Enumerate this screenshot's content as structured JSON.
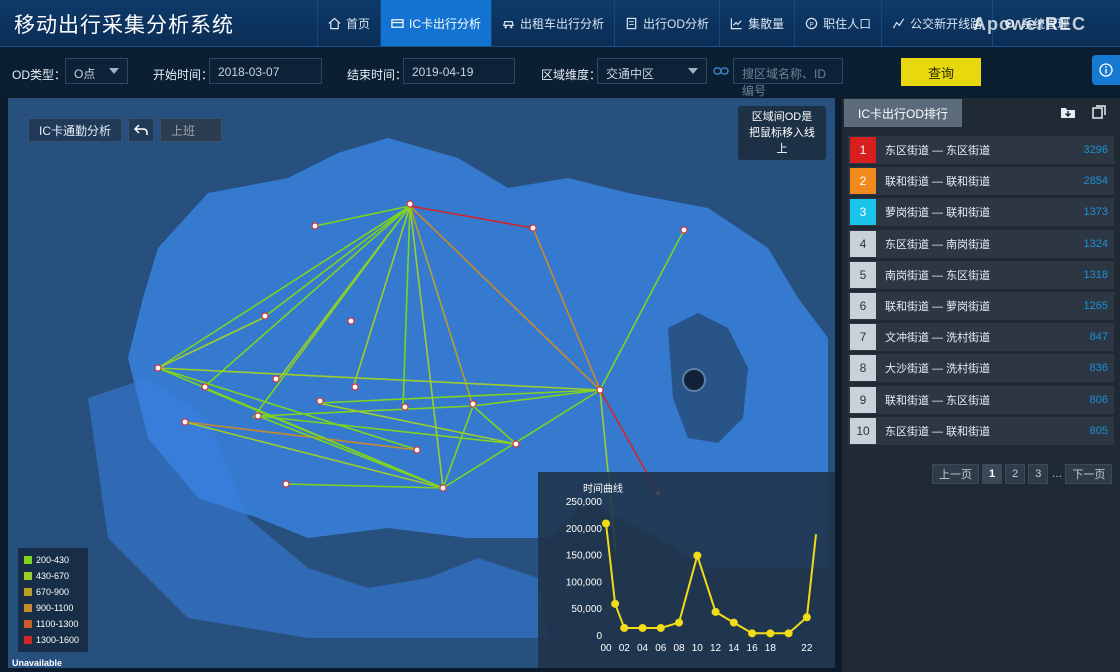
{
  "app": {
    "title": "移动出行采集分析系统"
  },
  "watermark": "ApowerREC",
  "nav": [
    {
      "label": "首页",
      "icon": "home-icon",
      "active": false
    },
    {
      "label": "IC卡出行分析",
      "icon": "card-icon",
      "active": true
    },
    {
      "label": "出租车出行分析",
      "icon": "taxi-icon",
      "active": false
    },
    {
      "label": "出行OD分析",
      "icon": "document-icon",
      "active": false
    },
    {
      "label": "集散量",
      "icon": "chart-icon",
      "active": false
    },
    {
      "label": "职住人口",
      "icon": "people-icon",
      "active": false
    },
    {
      "label": "公交新开线路",
      "icon": "route-icon",
      "active": false
    },
    {
      "label": "系统管理",
      "icon": "settings-icon",
      "active": false
    }
  ],
  "filters": {
    "od_type_label": "OD类型：",
    "od_type_value": "O点",
    "start_label": "开始时间：",
    "start_value": "2018-03-07",
    "end_label": "结束时间：",
    "end_value": "2019-04-19",
    "region_label": "区域维度：",
    "region_value": "交通中区",
    "search_placeholder": "搜区域名称、ID编号",
    "query_label": "查询"
  },
  "map": {
    "analysis_label": "IC卡通勤分析",
    "period_value": "上班",
    "hint_text_1": "区域间OD是",
    "hint_text_2": "把鼠标移入线上",
    "unavailable": "Unavailable",
    "legend": [
      {
        "label": "200-430",
        "color": "#7ed321"
      },
      {
        "label": "430-670",
        "color": "#9ccc2e"
      },
      {
        "label": "670-900",
        "color": "#b4a02a"
      },
      {
        "label": "900-1100",
        "color": "#c88a2c"
      },
      {
        "label": "1100-1300",
        "color": "#c8602a"
      },
      {
        "label": "1300-1600",
        "color": "#d0262a"
      }
    ]
  },
  "ranking": {
    "title": "IC卡出行OD排行",
    "rows": [
      {
        "rank": "1",
        "name": "东区街道 — 东区街道",
        "value": "3296",
        "color": "#d71f1f"
      },
      {
        "rank": "2",
        "name": "联和街道 — 联和街道",
        "value": "2854",
        "color": "#f28a1e"
      },
      {
        "rank": "3",
        "name": "萝岗街道 — 联和街道",
        "value": "1373",
        "color": "#1ac3e9"
      },
      {
        "rank": "4",
        "name": "东区街道 — 南岗街道",
        "value": "1324",
        "color": ""
      },
      {
        "rank": "5",
        "name": "南岗街道 — 东区街道",
        "value": "1318",
        "color": ""
      },
      {
        "rank": "6",
        "name": "联和街道 — 萝岗街道",
        "value": "1265",
        "color": ""
      },
      {
        "rank": "7",
        "name": "文冲街道 — 洗村街道",
        "value": "847",
        "color": ""
      },
      {
        "rank": "8",
        "name": "大沙街道 — 洗村街道",
        "value": "836",
        "color": ""
      },
      {
        "rank": "9",
        "name": "联和街道 — 东区街道",
        "value": "806",
        "color": ""
      },
      {
        "rank": "10",
        "name": "东区街道 — 联和街道",
        "value": "805",
        "color": ""
      }
    ],
    "pager": {
      "prev": "上一页",
      "pages": [
        "1",
        "2",
        "3"
      ],
      "ellipsis": "…",
      "next": "下一页",
      "current": "1"
    }
  },
  "chart_data": {
    "type": "line",
    "title": "时间曲线",
    "x": [
      "00",
      "01",
      "02",
      "03",
      "04",
      "05",
      "06",
      "07",
      "08",
      "09",
      "10",
      "11",
      "12",
      "13",
      "14",
      "15",
      "16",
      "17",
      "18",
      "19",
      "20",
      "21",
      "22",
      "23"
    ],
    "values": [
      210000,
      60000,
      15000,
      null,
      15000,
      null,
      15000,
      null,
      25000,
      null,
      150000,
      null,
      45000,
      null,
      25000,
      null,
      5000,
      null,
      5000,
      null,
      5000,
      null,
      35000,
      190000
    ],
    "xticks": [
      "00",
      "02",
      "04",
      "06",
      "08",
      "10",
      "12",
      "14",
      "16",
      "18",
      "22"
    ],
    "yticks": [
      "0",
      "50,000",
      "100,000",
      "150,000",
      "200,000",
      "250,000"
    ],
    "ylim": [
      0,
      250000
    ],
    "color": "#f2dc18"
  }
}
